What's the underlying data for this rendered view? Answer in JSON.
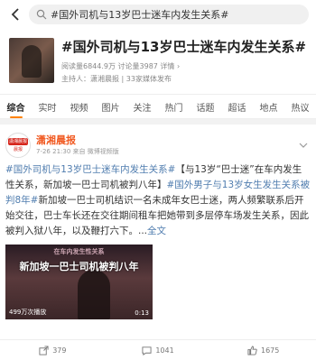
{
  "search": {
    "query": "#国外司机与13岁巴士迷车内发生关系#"
  },
  "topic": {
    "title": "#国外司机与13岁巴士迷车内发生关系#",
    "stats": "阅读量6844.9万 讨论量3987 详情 ›",
    "host": "主持人：潇湘晨报 | 33家媒体发布"
  },
  "tabs": [
    "综合",
    "实时",
    "视频",
    "图片",
    "关注",
    "热门",
    "话题",
    "超话",
    "地点",
    "热议"
  ],
  "post": {
    "author": "潇湘晨报",
    "avatar_top": "潇湘晨报",
    "avatar_bottom": "晨报",
    "meta": "7-26 21:30 来自 微博视频版",
    "text": {
      "tag1": "#国外司机与13岁巴士迷车内发生关系#",
      "title": "【与13岁“巴士迷”在车内发生性关系，新加坡一巴士司机被判八年】",
      "tag2": "#国外男子与13岁女生发生关系被判8年#",
      "body": "新加坡一巴士司机结识一名未成年女巴士迷，两人频繁联系后开始交往，巴士车长还在交往期间租车把她带到多层停车场发生关系，因此被判入狱八年，以及鞭打六下。...",
      "full": "全文"
    },
    "video": {
      "top_text": "在车内发生性关系",
      "title": "新加坡一巴士司机被判八年",
      "plays": "499万次播放",
      "duration": "0:13"
    }
  },
  "actions": {
    "share": "379",
    "comment": "1041",
    "like": "1675"
  }
}
